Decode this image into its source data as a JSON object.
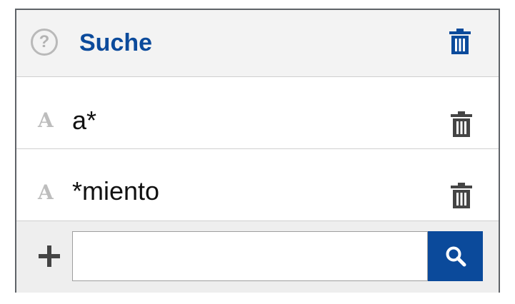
{
  "header": {
    "title": "Suche",
    "help_icon": "question-circle-icon",
    "delete_icon": "trash-icon",
    "accent_color": "#0b4a9b"
  },
  "terms": [
    {
      "type_icon": "A",
      "type_icon_name": "text-type-icon",
      "text": "a*",
      "delete_icon": "trash-icon"
    },
    {
      "type_icon": "A",
      "type_icon_name": "text-type-icon",
      "text": "*miento",
      "delete_icon": "trash-icon"
    }
  ],
  "footer": {
    "add_icon": "plus-icon",
    "search_value": "",
    "search_placeholder": "",
    "search_button_icon": "magnifier-icon"
  }
}
